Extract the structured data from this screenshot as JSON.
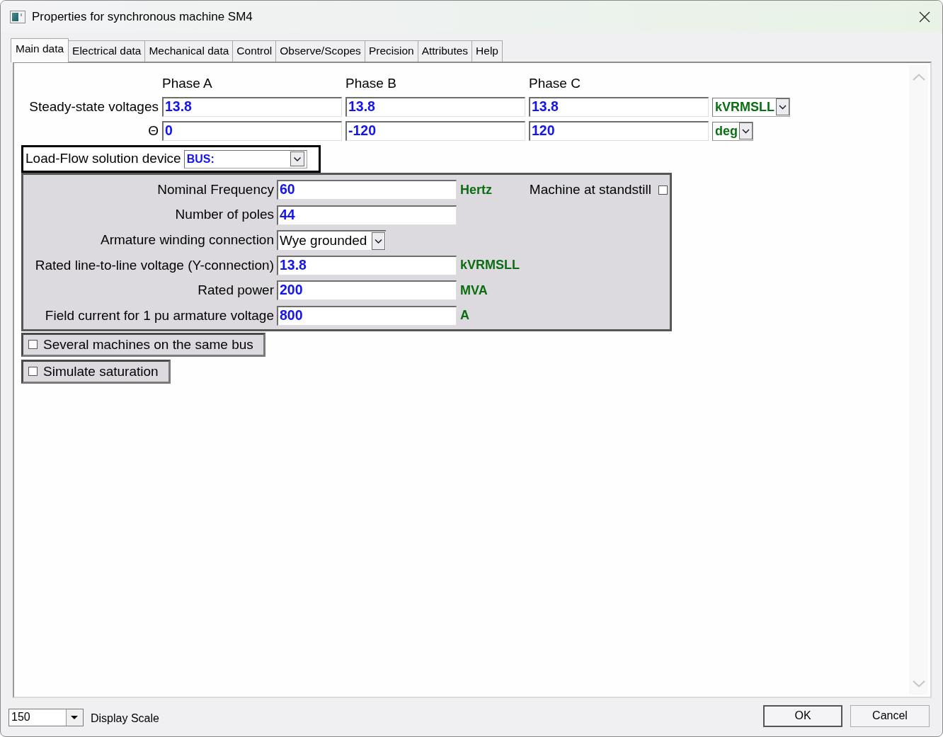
{
  "window": {
    "title": "Properties for synchronous machine SM4"
  },
  "tabs": [
    {
      "label": "Main data",
      "selected": true
    },
    {
      "label": "Electrical data",
      "selected": false
    },
    {
      "label": "Mechanical data",
      "selected": false
    },
    {
      "label": "Control",
      "selected": false
    },
    {
      "label": "Observe/Scopes",
      "selected": false
    },
    {
      "label": "Precision",
      "selected": false
    },
    {
      "label": "Attributes",
      "selected": false
    },
    {
      "label": "Help",
      "selected": false
    }
  ],
  "phase_table": {
    "columns": [
      "Phase A",
      "Phase B",
      "Phase C"
    ],
    "rows": [
      {
        "label": "Steady-state voltages",
        "values": [
          "13.8",
          "13.8",
          "13.8"
        ],
        "unit": "kVRMSLL"
      },
      {
        "label": "Θ",
        "values": [
          "0",
          "-120",
          "120"
        ],
        "unit": "deg"
      }
    ]
  },
  "load_flow": {
    "label": "Load-Flow solution device",
    "value": "BUS:"
  },
  "parameters": [
    {
      "label": "Nominal Frequency",
      "kind": "input",
      "value": "60",
      "unit": "Hertz"
    },
    {
      "label": "Number of poles",
      "kind": "input",
      "value": "44"
    },
    {
      "label": "Armature winding connection",
      "kind": "select",
      "value": "Wye grounded"
    },
    {
      "label": "Rated line-to-line voltage (Y-connection)",
      "kind": "input",
      "value": "13.8",
      "unit": "kVRMSLL"
    },
    {
      "label": "Rated power",
      "kind": "input",
      "value": "200",
      "unit": "MVA"
    },
    {
      "label": "Field current for 1 pu armature voltage",
      "kind": "input",
      "value": "800",
      "unit": "A"
    }
  ],
  "machine_at_standstill": {
    "label": "Machine at standstill",
    "checked": false
  },
  "options": [
    {
      "label": "Several machines on the same bus",
      "checked": false
    },
    {
      "label": "Simulate saturation",
      "checked": false
    }
  ],
  "display_scale": {
    "value": "150",
    "label": "Display Scale"
  },
  "buttons": [
    "OK",
    "Cancel"
  ]
}
